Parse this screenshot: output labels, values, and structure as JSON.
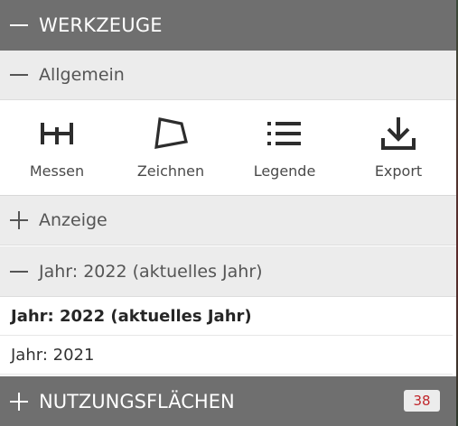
{
  "werkzeuge": {
    "title": "WERKZEUGE",
    "state_icon": "minus-icon"
  },
  "allgemein": {
    "title": "Allgemein",
    "state_icon": "minus-icon",
    "tools": [
      {
        "label": "Messen",
        "icon": "measure-icon"
      },
      {
        "label": "Zeichnen",
        "icon": "draw-polygon-icon"
      },
      {
        "label": "Legende",
        "icon": "list-icon"
      },
      {
        "label": "Export",
        "icon": "download-icon"
      }
    ]
  },
  "anzeige": {
    "title": "Anzeige",
    "state_icon": "plus-icon"
  },
  "jahr": {
    "title": "Jahr: 2022 (aktuelles Jahr)",
    "state_icon": "minus-icon",
    "items": [
      {
        "label": "Jahr: 2022 (aktuelles Jahr)",
        "selected": true
      },
      {
        "label": "Jahr: 2021",
        "selected": false
      }
    ]
  },
  "nutzungsflaechen": {
    "title": "NUTZUNGSFLÄCHEN",
    "state_icon": "plus-icon",
    "count": "38",
    "badge_color": "#c0262b"
  },
  "colors": {
    "header_bg": "#6f6f6f",
    "subheader_bg": "#ececec",
    "text": "#4a4a4a"
  }
}
